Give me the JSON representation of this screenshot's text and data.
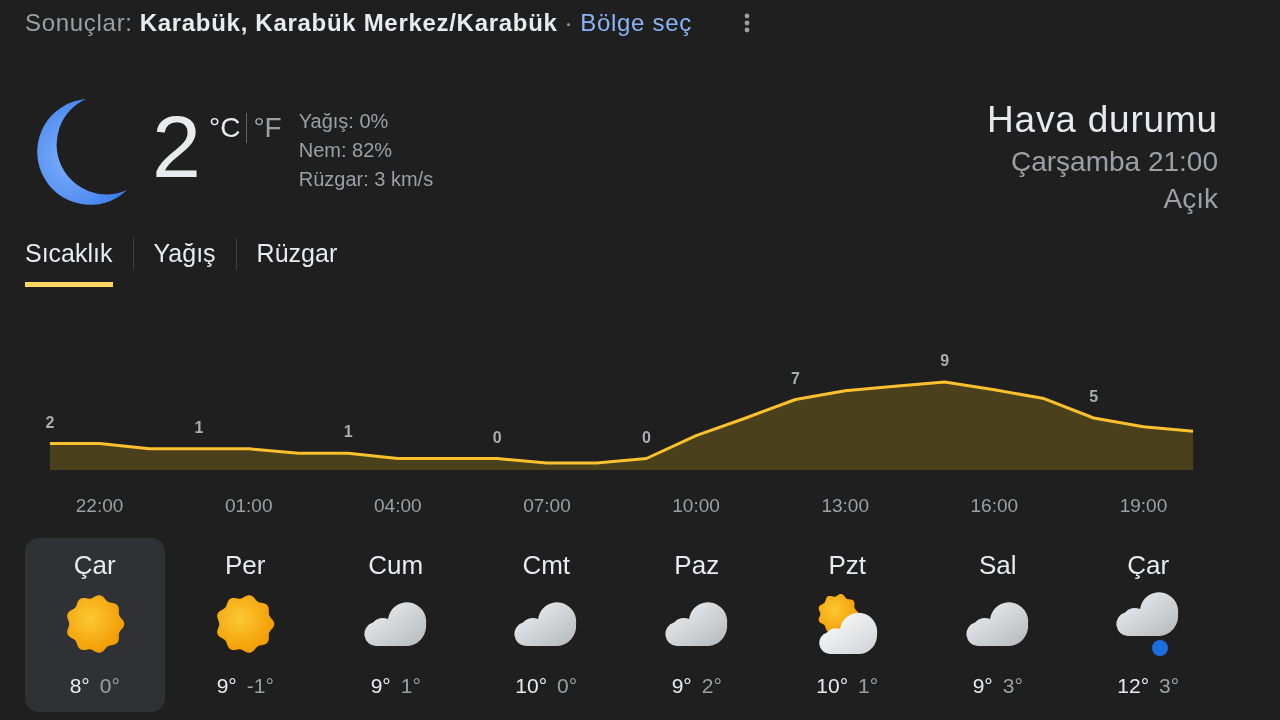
{
  "header": {
    "results_label": "Sonuçlar:",
    "location": "Karabük, Karabük Merkez/Karabük",
    "separator": "·",
    "region_link": "Bölge seç"
  },
  "current": {
    "kind": "clear_night",
    "temperature": "2",
    "units": [
      {
        "label": "°C",
        "selected": true
      },
      {
        "label": "°F",
        "selected": false
      }
    ],
    "details": [
      "Yağış: 0%",
      "Nem: 82%",
      "Rüzgar: 3 km/s"
    ],
    "title": "Hava durumu",
    "datetime": "Çarşamba 21:00",
    "description": "Açık"
  },
  "tabs": [
    {
      "label": "Sıcaklık",
      "selected": true
    },
    {
      "label": "Yağış",
      "selected": false
    },
    {
      "label": "Rüzgar",
      "selected": false
    }
  ],
  "hourly": {
    "chart_data": {
      "type": "area",
      "categories": [
        null,
        "22:00",
        null,
        null,
        "01:00",
        null,
        null,
        "04:00",
        null,
        null,
        "07:00",
        null,
        null,
        "10:00",
        null,
        null,
        "13:00",
        null,
        null,
        "16:00",
        null,
        null,
        "19:00",
        null
      ],
      "values": [
        2,
        2,
        1.4,
        1.4,
        1.4,
        0.9,
        0.9,
        0.3,
        0.3,
        0.3,
        -0.2,
        -0.2,
        0.3,
        2.9,
        4.9,
        7,
        8,
        8.5,
        9,
        8.1,
        7.1,
        4.9,
        3.9,
        3.4
      ],
      "value_labels": [
        "2",
        null,
        null,
        "1",
        null,
        null,
        "1",
        null,
        null,
        "0",
        null,
        null,
        "0",
        null,
        null,
        "7",
        null,
        null,
        "9",
        null,
        null,
        "5",
        null,
        null
      ]
    }
  },
  "days": [
    {
      "name": "Çar",
      "kind": "sunny",
      "high": "8°",
      "low": "0°",
      "selected": true
    },
    {
      "name": "Per",
      "kind": "sunny",
      "high": "9°",
      "low": "-1°",
      "selected": false
    },
    {
      "name": "Cum",
      "kind": "cloudy",
      "high": "9°",
      "low": "1°",
      "selected": false
    },
    {
      "name": "Cmt",
      "kind": "cloudy",
      "high": "10°",
      "low": "0°",
      "selected": false
    },
    {
      "name": "Paz",
      "kind": "cloudy",
      "high": "9°",
      "low": "2°",
      "selected": false
    },
    {
      "name": "Pzt",
      "kind": "partly_cloudy",
      "high": "10°",
      "low": "1°",
      "selected": false
    },
    {
      "name": "Sal",
      "kind": "cloudy",
      "high": "9°",
      "low": "3°",
      "selected": false
    },
    {
      "name": "Çar",
      "kind": "rain",
      "high": "12°",
      "low": "3°",
      "selected": false
    }
  ]
}
